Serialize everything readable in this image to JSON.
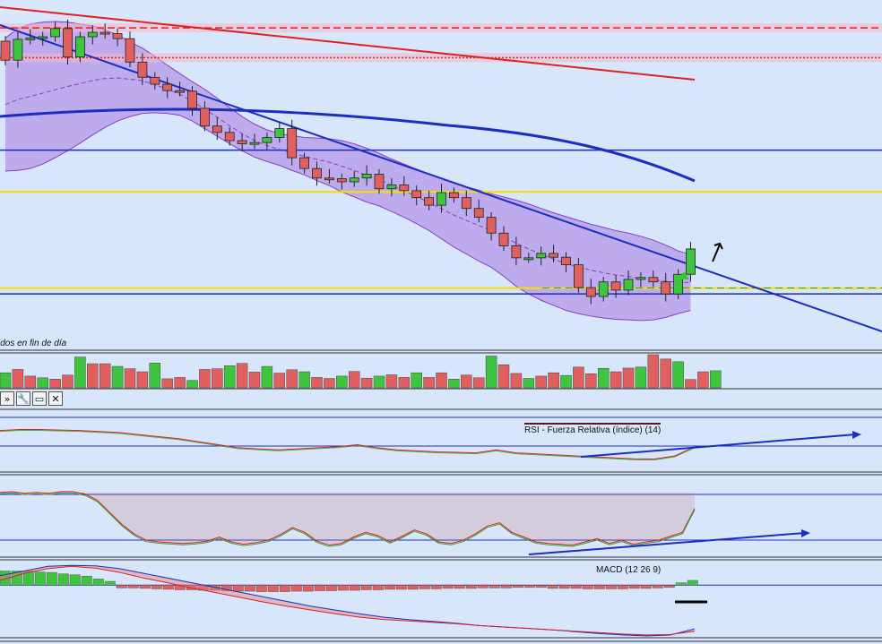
{
  "panels": {
    "price_caption": "idos en fin de día",
    "rsi_label": "RSI - Fuerza Relativa (índice) (14)",
    "macd_label": "MACD (12 26 9)"
  },
  "toolbar": {
    "buttons": [
      {
        "icon": "chevron-icon",
        "glyph": "»"
      },
      {
        "icon": "wrench-icon",
        "glyph": "🔧"
      },
      {
        "icon": "window-icon",
        "glyph": "▭"
      },
      {
        "icon": "close-icon",
        "glyph": "✕"
      }
    ]
  },
  "colors": {
    "background": "#d8e6fb",
    "up_candle": "#3ec43e",
    "down_candle": "#e06060",
    "bollinger_fill": "#b9a0ea",
    "trendline": "#1c2dc4",
    "long_ma": "#e02020",
    "support_yellow": "#f4e000",
    "rsi_line": "#2e9e2e"
  },
  "chart_data": [
    {
      "type": "candlestick",
      "title": "",
      "closes": [
        94.5,
        97.8,
        98.0,
        98.2,
        99.5,
        95.0,
        98.2,
        98.9,
        98.7,
        97.9,
        94.2,
        91.8,
        90.7,
        89.7,
        89.6,
        86.9,
        84.1,
        83.1,
        81.8,
        81.3,
        81.5,
        82.3,
        83.7,
        79.1,
        77.4,
        75.9,
        75.8,
        75.3,
        75.9,
        76.5,
        74.2,
        74.8,
        73.9,
        72.8,
        71.6,
        73.6,
        72.8,
        71.1,
        69.7,
        67.2,
        65.2,
        63.3,
        63.3,
        64.0,
        63.4,
        62.2,
        58.6,
        57.2,
        59.5,
        58.2,
        59.9,
        60.2,
        59.5,
        57.6,
        60.7,
        64.7
      ],
      "bollinger_upper": [
        98,
        99.5,
        100.2,
        100.5,
        100.6,
        100.5,
        100.2,
        99.9,
        99.3,
        98.5,
        97.4,
        96.4,
        95.1,
        93.7,
        92.4,
        91.1,
        89.9,
        88.5,
        87.0,
        85.6,
        84.4,
        83.5,
        82.9,
        82.6,
        82.3,
        82.2,
        82.1,
        81.8,
        81.3,
        80.6,
        79.8,
        78.9,
        78.1,
        77.3,
        76.5,
        75.8,
        75.1,
        74.5,
        74.0,
        73.4,
        72.9,
        72.4,
        71.8,
        71.1,
        70.4,
        69.8,
        69.2,
        68.6,
        68.1,
        67.6,
        67.2,
        66.7,
        66.1,
        65.3,
        64.4,
        63.8
      ],
      "bollinger_lower": [
        77,
        77.1,
        77.4,
        78.1,
        79.1,
        80.2,
        81.4,
        82.7,
        83.9,
        84.9,
        85.6,
        86.1,
        86.2,
        86.1,
        85.8,
        84.9,
        83.7,
        82.5,
        81.3,
        80.2,
        79.2,
        78.5,
        77.9,
        77.1,
        76.4,
        75.5,
        74.7,
        73.7,
        72.9,
        72.1,
        71.5,
        70.6,
        69.7,
        68.7,
        67.6,
        66.3,
        65.0,
        63.9,
        62.8,
        61.8,
        60.4,
        58.8,
        57.6,
        56.6,
        55.8,
        55.0,
        54.5,
        54.1,
        53.8,
        53.6,
        53.5,
        53.4,
        53.5,
        53.9,
        54.5,
        55.0
      ],
      "moving_average_mid": 90,
      "horizontal_lines": [
        99.6,
        94.9,
        80.3,
        73.7,
        58.5,
        57.6
      ],
      "ylim": [
        49,
        104
      ]
    },
    {
      "type": "bar",
      "title": "",
      "values": [
        45,
        55,
        35,
        30,
        26,
        38,
        92,
        72,
        72,
        64,
        57,
        48,
        74,
        27,
        31,
        22,
        55,
        57,
        66,
        73,
        47,
        64,
        44,
        54,
        48,
        31,
        28,
        35,
        49,
        29,
        35,
        39,
        31,
        45,
        31,
        45,
        26,
        38,
        30,
        95,
        69,
        43,
        28,
        35,
        45,
        37,
        62,
        42,
        58,
        48,
        59,
        62,
        99,
        86,
        78,
        25,
        48,
        51
      ]
    },
    {
      "type": "line",
      "title": "RSI - Fuerza Relativa (índice) (14)",
      "values": [
        60,
        61,
        61,
        60.5,
        60,
        59,
        58,
        56,
        54,
        52,
        49,
        46,
        43,
        42,
        41,
        42,
        43,
        44,
        46,
        43,
        41,
        40,
        39,
        38.5,
        38,
        41,
        38,
        37,
        36,
        35,
        34,
        33,
        32,
        32,
        35,
        44
      ],
      "ylim": [
        20,
        80
      ]
    },
    {
      "type": "line",
      "title": "",
      "values": [
        80,
        81,
        79,
        80,
        79,
        81,
        81,
        78,
        70,
        55,
        40,
        28,
        20,
        18,
        17,
        16,
        17,
        19,
        24,
        18,
        15,
        17,
        20,
        27,
        36,
        30,
        19,
        14,
        16,
        24,
        30,
        26,
        18,
        25,
        33,
        28,
        18,
        16,
        20,
        28,
        38,
        42,
        30,
        24,
        18,
        16,
        15,
        14,
        18,
        22,
        16,
        20,
        15,
        18,
        20,
        25,
        30,
        60
      ],
      "ylim": [
        0,
        100
      ]
    },
    {
      "type": "bar",
      "title": "MACD (12 26 9)",
      "histogram": [
        3.0,
        3.0,
        3.0,
        2.8,
        2.7,
        2.4,
        2.2,
        1.9,
        1.3,
        0.8,
        -0.6,
        -0.6,
        -0.7,
        -0.8,
        -0.9,
        -1.0,
        -1.0,
        -1.1,
        -1.1,
        -1.2,
        -1.3,
        -1.3,
        -1.4,
        -1.4,
        -1.4,
        -1.3,
        -1.3,
        -1.2,
        -1.2,
        -1.1,
        -1.1,
        -1.0,
        -1.0,
        -0.9,
        -0.9,
        -0.9,
        -0.8,
        -0.8,
        -0.7,
        -0.7,
        -0.7,
        -0.6,
        -0.6,
        -0.6,
        -0.5,
        -0.5,
        -0.5,
        -0.7,
        -0.7,
        -0.7,
        -0.8,
        -0.8,
        -0.8,
        -0.8,
        -0.7,
        -0.7,
        -0.6,
        -0.5,
        0.5,
        1.0
      ],
      "macd_line": [
        2.0,
        3.0,
        4.0,
        4.2,
        4.1,
        3.5,
        2.5,
        1.5,
        0.5,
        -0.5,
        -1.5,
        -2.5,
        -3.5,
        -4.5,
        -5.3,
        -6.1,
        -6.8,
        -7.3,
        -7.7,
        -8.1,
        -8.6,
        -8.9,
        -9.2,
        -9.5,
        -9.9,
        -10.3,
        -10.6,
        -10.8,
        -10.6,
        -9.3
      ],
      "signal_line": [
        1.0,
        2.5,
        3.5,
        4.0,
        3.6,
        2.7,
        1.5,
        0.5,
        -0.6,
        -1.6,
        -2.6,
        -3.6,
        -4.5,
        -5.3,
        -6.1,
        -6.8,
        -7.3,
        -7.6,
        -7.9,
        -8.2,
        -8.6,
        -8.9,
        -9.2,
        -9.5,
        -9.8,
        -10.1,
        -10.4,
        -10.6,
        -10.5,
        -9.8
      ],
      "ylim": [
        -11,
        5
      ]
    }
  ]
}
